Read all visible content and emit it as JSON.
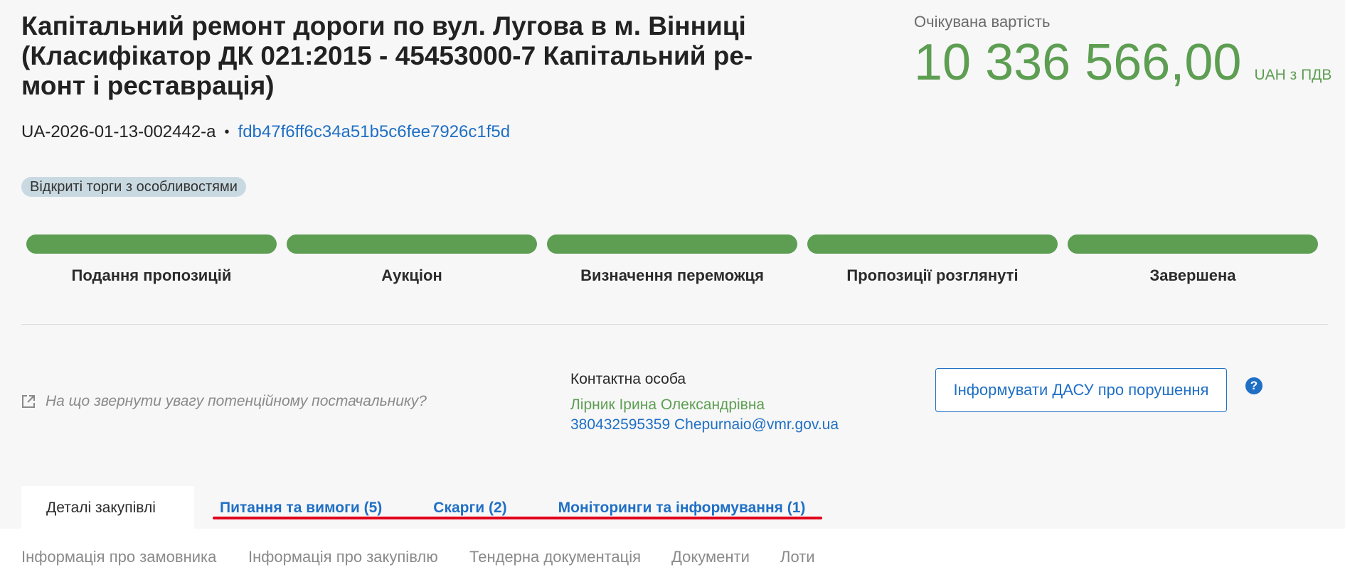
{
  "header": {
    "title": "Капітальний ремонт дороги по вул. Лугова в м. Вінниці (Класифікатор ДК 021:2015 - 45453000-7 Капітальний ре-монт і реставрація)",
    "tender_id": "UA-2026-01-13-002442-a",
    "separator": "•",
    "hash": "fdb47f6ff6c34a51b5c6fee7926c1f5d"
  },
  "price": {
    "label": "Очікувана вартість",
    "amount": "10 336 566,00",
    "currency": "UAH з ПДВ"
  },
  "procedure_tag": "Відкриті торги з особливостями",
  "stages": [
    {
      "label": "Подання пропозицій",
      "completed": true
    },
    {
      "label": "Аукціон",
      "completed": true
    },
    {
      "label": "Визначення переможця",
      "completed": true
    },
    {
      "label": "Пропозиції розглянуті",
      "completed": true
    },
    {
      "label": "Завершена",
      "completed": true
    }
  ],
  "hint_link": "На що звернути увагу потенційному постачальнику?",
  "contact": {
    "label": "Контактна особа",
    "name": "Лірник Ірина Олександрівна",
    "phone_email": "380432595359 Chepurnaio@vmr.gov.ua"
  },
  "dasu_button": "Інформувати ДАСУ про порушення",
  "help_icon": "?",
  "tabs": [
    {
      "label": "Деталі закупівлі",
      "active": true
    },
    {
      "label": "Питання та вимоги (5)",
      "active": false
    },
    {
      "label": "Скарги (2)",
      "active": false
    },
    {
      "label": "Моніторинги та інформування (1)",
      "active": false
    }
  ],
  "subnav": [
    "Інформація про замовника",
    "Інформація про закупівлю",
    "Тендерна документація",
    "Документи",
    "Лоти"
  ],
  "colors": {
    "accent_green": "#5d9e52",
    "link_blue": "#1f6fc5",
    "highlight_red": "#e0001b"
  }
}
